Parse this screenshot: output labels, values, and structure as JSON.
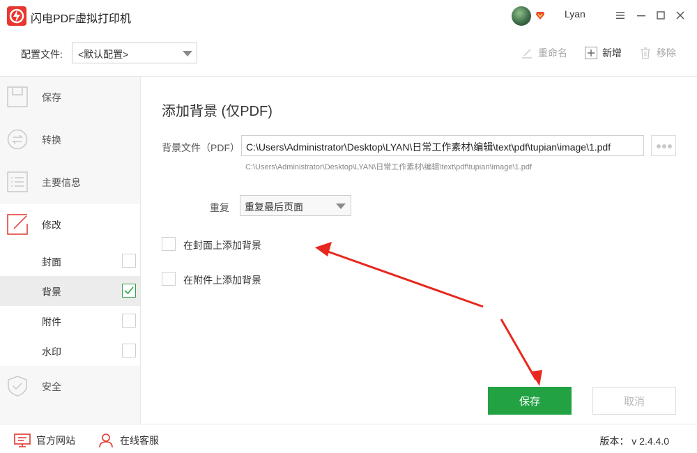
{
  "app": {
    "title": "闪电PDF虚拟打印机",
    "user_name": "Lyan",
    "accent": "#e8372f"
  },
  "config": {
    "label": "配置文件:",
    "selected": "<默认配置>",
    "rename_label": "重命名",
    "add_label": "新增",
    "remove_label": "移除"
  },
  "sidebar": {
    "items": [
      {
        "label": "保存",
        "icon": "save-icon"
      },
      {
        "label": "转换",
        "icon": "convert-icon"
      },
      {
        "label": "主要信息",
        "icon": "info-list-icon"
      },
      {
        "label": "修改",
        "icon": "edit-icon"
      }
    ],
    "sub_items": [
      {
        "label": "封面",
        "checked": false
      },
      {
        "label": "背景",
        "checked": true
      },
      {
        "label": "附件",
        "checked": false
      },
      {
        "label": "水印",
        "checked": false
      }
    ],
    "security": {
      "label": "安全",
      "icon": "shield-icon"
    }
  },
  "main": {
    "title": "添加背景 (仅PDF)",
    "bg_file_label": "背景文件（PDF）",
    "bg_file_value": "C:\\Users\\Administrator\\Desktop\\LYAN\\日常工作素材\\编辑\\text\\pdf\\tupian\\image\\1.pdf",
    "bg_file_hint": "C:\\Users\\Administrator\\Desktop\\LYAN\\日常工作素材\\编辑\\text\\pdf\\tupian\\image\\1.pdf",
    "repeat_label": "重复",
    "repeat_value": "重复最后页面",
    "add_on_cover_label": "在封面上添加背景",
    "add_on_attachment_label": "在附件上添加背景",
    "save_label": "保存",
    "cancel_label": "取消",
    "save_color": "#23a243"
  },
  "footer": {
    "website_label": "官方网站",
    "service_label": "在线客服",
    "version": "版本： v 2.4.4.0"
  }
}
